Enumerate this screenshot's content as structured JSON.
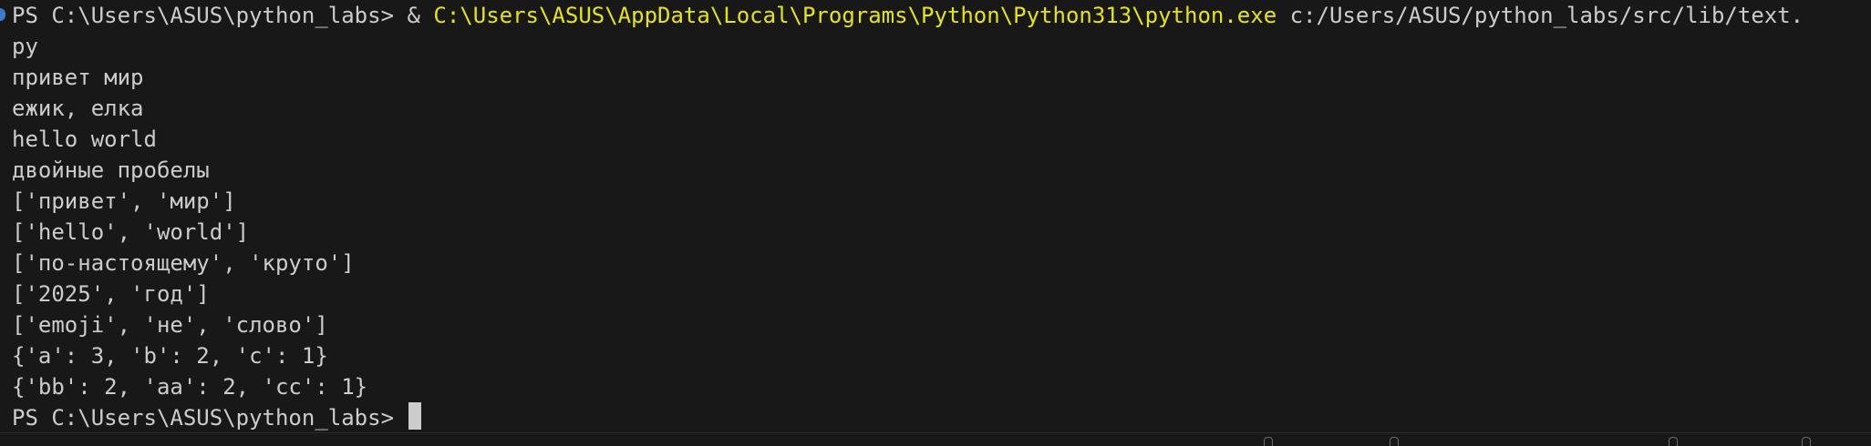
{
  "terminal": {
    "command_line": {
      "prompt": "PS C:\\Users\\ASUS\\python_labs> ",
      "call_operator": "& ",
      "executable": "C:\\Users\\ASUS\\AppData\\Local\\Programs\\Python\\Python313\\python.exe",
      "script_arg": " c:/Users/ASUS/python_labs/src/lib/text.",
      "script_arg_wrap": "py"
    },
    "output_lines": [
      "привет мир",
      "ежик, елка",
      "hello world",
      "двойные пробелы",
      "['привет', 'мир']",
      "['hello', 'world']",
      "['по-настоящему', 'круто']",
      "['2025', 'год']",
      "['emoji', 'не', 'слово']",
      "{'a': 3, 'b': 2, 'c': 1}",
      "{'bb': 2, 'aa': 2, 'cc': 1}"
    ],
    "final_prompt": "PS C:\\Users\\ASUS\\python_labs> "
  },
  "colors": {
    "background": "#181818",
    "foreground": "#cccccc",
    "executable": "#e5e510",
    "command_decoration": "#3b7ad0"
  }
}
